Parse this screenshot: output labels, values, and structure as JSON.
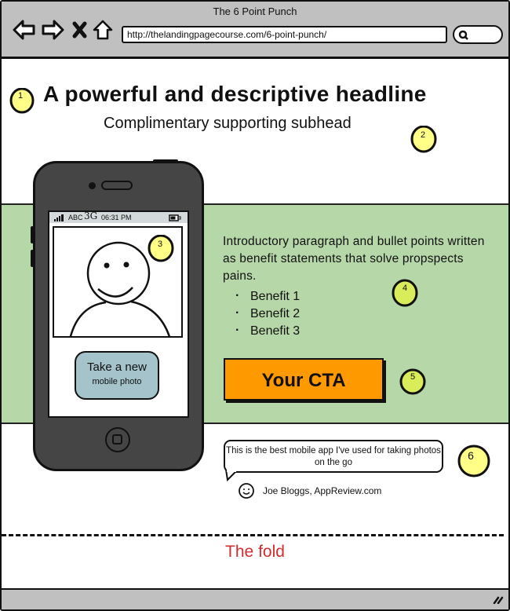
{
  "browser": {
    "title": "The 6 Point Punch",
    "url": "http://thelandingpagecourse.com/6-point-punch/",
    "nav": {
      "back_icon": "arrow-left-icon",
      "forward_icon": "arrow-right-icon",
      "stop_icon": "close-icon",
      "home_icon": "home-icon",
      "search_icon": "search-icon"
    }
  },
  "page": {
    "headline": "A powerful and descriptive headline",
    "subhead": "Complimentary supporting subhead",
    "phone": {
      "status": {
        "carrier": "ABC",
        "network": "3G",
        "time": "06:31 PM"
      },
      "button": {
        "line1": "Take a new",
        "line2": "mobile photo"
      }
    },
    "intro": "Introductory paragraph and bullet points written as benefit statements that solve propspects pains.",
    "benefits": [
      "Benefit 1",
      "Benefit 2",
      "Benefit 3"
    ],
    "cta_label": "Your CTA",
    "testimonial": {
      "quote": "This is the best mobile app I've used for taking photos on the go",
      "author": "Joe Bloggs, AppReview.com"
    },
    "fold_label": "The fold"
  },
  "badges": [
    "1",
    "2",
    "3",
    "4",
    "5",
    "6"
  ],
  "colors": {
    "band": "#b6d7a8",
    "cta": "#ff9900",
    "badge": "#ffff88",
    "badge_alt": "#d9ed5a",
    "phone_button": "#a4c3cb",
    "fold": "#d32d2d",
    "chrome": "#c0c0c0"
  }
}
